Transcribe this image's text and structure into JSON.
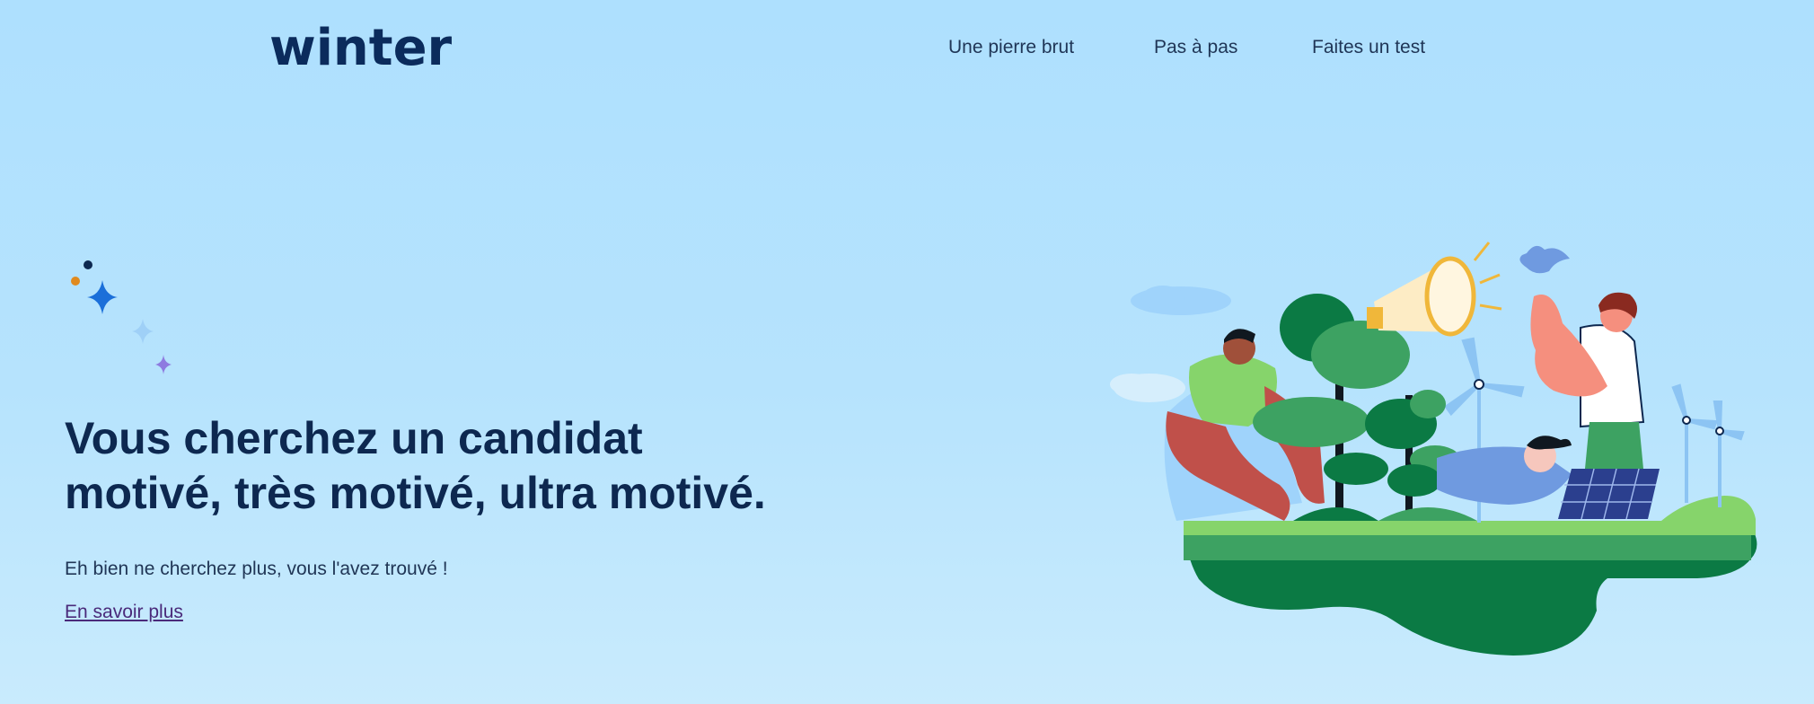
{
  "brand": {
    "logo_text": "winter"
  },
  "nav": {
    "items": [
      {
        "label": "Une pierre brut"
      },
      {
        "label": "Pas à pas"
      },
      {
        "label": "Faites un test"
      }
    ]
  },
  "hero": {
    "headline_line1": "Vous cherchez un candidat",
    "headline_line2": "motivé, très motivé, ultra motivé.",
    "subtitle": "Eh bien ne cherchez plus, vous l'avez trouvé !",
    "cta_label": "En savoir plus"
  },
  "colors": {
    "background": "#aee0fe",
    "text_dark": "#0d2850",
    "link": "#4a2a7a",
    "sparkle_blue": "#1b6fd9",
    "sparkle_light": "#9fd0f7",
    "sparkle_purple": "#8e7be0",
    "sparkle_orange": "#e08a1e",
    "ground_green": "#0b7a44",
    "grass_green": "#7fcf6a"
  },
  "icons": {
    "decor": "sparkles-icon",
    "illustration": "sustainability-illustration"
  }
}
